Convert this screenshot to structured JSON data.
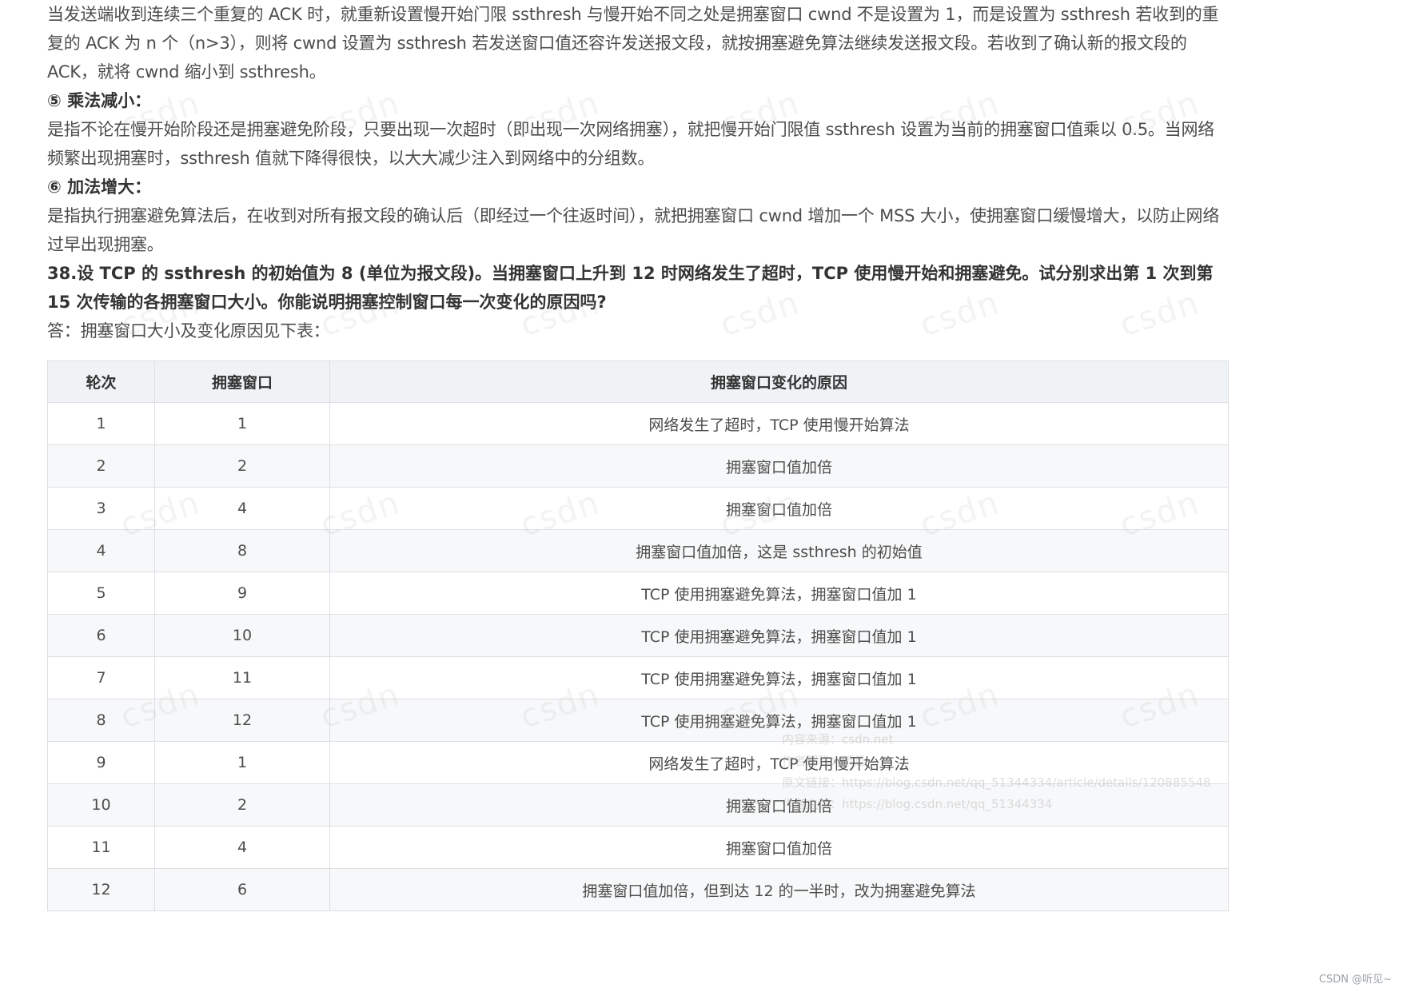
{
  "paragraphs": {
    "p1": "当发送端收到连续三个重复的 ACK 时，就重新设置慢开始门限 ssthresh 与慢开始不同之处是拥塞窗口 cwnd 不是设置为 1，而是设置为 ssthresh 若收到的重复的 ACK 为 n 个（n>3），则将 cwnd 设置为 ssthresh 若发送窗口值还容许发送报文段，就按拥塞避免算法继续发送报文段。若收到了确认新的报文段的 ACK，就将 cwnd 缩小到 ssthresh。",
    "h5": "⑤ 乘法减小：",
    "p2": "是指不论在慢开始阶段还是拥塞避免阶段，只要出现一次超时（即出现一次网络拥塞），就把慢开始门限值 ssthresh 设置为当前的拥塞窗口值乘以 0.5。当网络频繁出现拥塞时，ssthresh 值就下降得很快，以大大减少注入到网络中的分组数。",
    "h6": "⑥ 加法增大：",
    "p3": "是指执行拥塞避免算法后，在收到对所有报文段的确认后（即经过一个往返时间），就把拥塞窗口 cwnd 增加一个 MSS 大小，使拥塞窗口缓慢增大，以防止网络过早出现拥塞。",
    "question": "38.设 TCP 的 ssthresh 的初始值为 8 (单位为报文段)。当拥塞窗口上升到 12 时网络发生了超时，TCP 使用慢开始和拥塞避免。试分别求出第 1 次到第 15 次传输的各拥塞窗口大小。你能说明拥塞控制窗口每一次变化的原因吗?",
    "answer": "答：拥塞窗口大小及变化原因见下表："
  },
  "table": {
    "headers": [
      "轮次",
      "拥塞窗口",
      "拥塞窗口变化的原因"
    ],
    "rows": [
      [
        "1",
        "1",
        "网络发生了超时，TCP 使用慢开始算法"
      ],
      [
        "2",
        "2",
        "拥塞窗口值加倍"
      ],
      [
        "3",
        "4",
        "拥塞窗口值加倍"
      ],
      [
        "4",
        "8",
        "拥塞窗口值加倍，这是 ssthresh 的初始值"
      ],
      [
        "5",
        "9",
        "TCP 使用拥塞避免算法，拥塞窗口值加 1"
      ],
      [
        "6",
        "10",
        "TCP 使用拥塞避免算法，拥塞窗口值加 1"
      ],
      [
        "7",
        "11",
        "TCP 使用拥塞避免算法，拥塞窗口值加 1"
      ],
      [
        "8",
        "12",
        "TCP 使用拥塞避免算法，拥塞窗口值加 1"
      ],
      [
        "9",
        "1",
        "网络发生了超时，TCP 使用慢开始算法"
      ],
      [
        "10",
        "2",
        "拥塞窗口值加倍"
      ],
      [
        "11",
        "4",
        "拥塞窗口值加倍"
      ],
      [
        "12",
        "6",
        "拥塞窗口值加倍，但到达 12 的一半时，改为拥塞避免算法"
      ]
    ]
  },
  "watermark": {
    "text": "csdn",
    "source_lines": [
      "内容来源：csdn.net",
      "作者昵称：听见~",
      "原文链接：https://blog.csdn.net/qq_51344334/article/details/120885548",
      "作者主页：https://blog.csdn.net/qq_51344334"
    ]
  },
  "footer": {
    "credit": "CSDN @听见~"
  }
}
